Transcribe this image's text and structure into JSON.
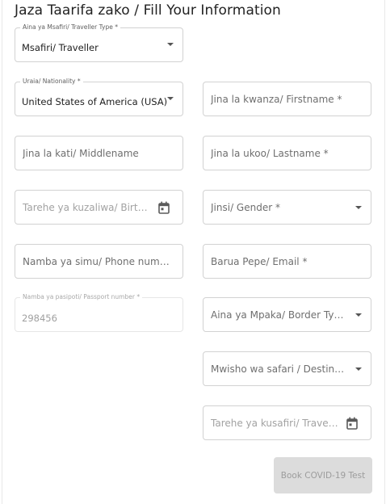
{
  "form": {
    "title": "Jaza Taarifa zako / Fill Your Information",
    "traveller_type": {
      "label": "Aina ya Msafiri/ Traveller Type *",
      "value": "Msafiri/ Traveller"
    },
    "nationality": {
      "label": "Uraia/ Nationality *",
      "value": "United States of America (USA)"
    },
    "firstname": {
      "placeholder": "Jina la kwanza/ Firstname *"
    },
    "middlename": {
      "placeholder": "Jina la kati/ Middlename"
    },
    "lastname": {
      "placeholder": "Jina la ukoo/ Lastname *"
    },
    "birthdate": {
      "placeholder": "Tarehe ya kuzaliwa/ Birthd..."
    },
    "gender": {
      "placeholder": "Jinsi/ Gender *"
    },
    "phone": {
      "placeholder": "Namba ya simu/ Phone number"
    },
    "email": {
      "placeholder": "Barua Pepe/ Email *"
    },
    "passport": {
      "label": "Namba ya pasipoti/ Passport number *",
      "value": "298456"
    },
    "border_type": {
      "placeholder": "Aina ya Mpaka/ Border Type *"
    },
    "destination": {
      "placeholder": "Mwisho wa safari / Destinatio..."
    },
    "travel_date": {
      "placeholder": "Tarehe ya kusafiri/ Travelli..."
    },
    "submit_label": "Book COVID-19 Test"
  }
}
